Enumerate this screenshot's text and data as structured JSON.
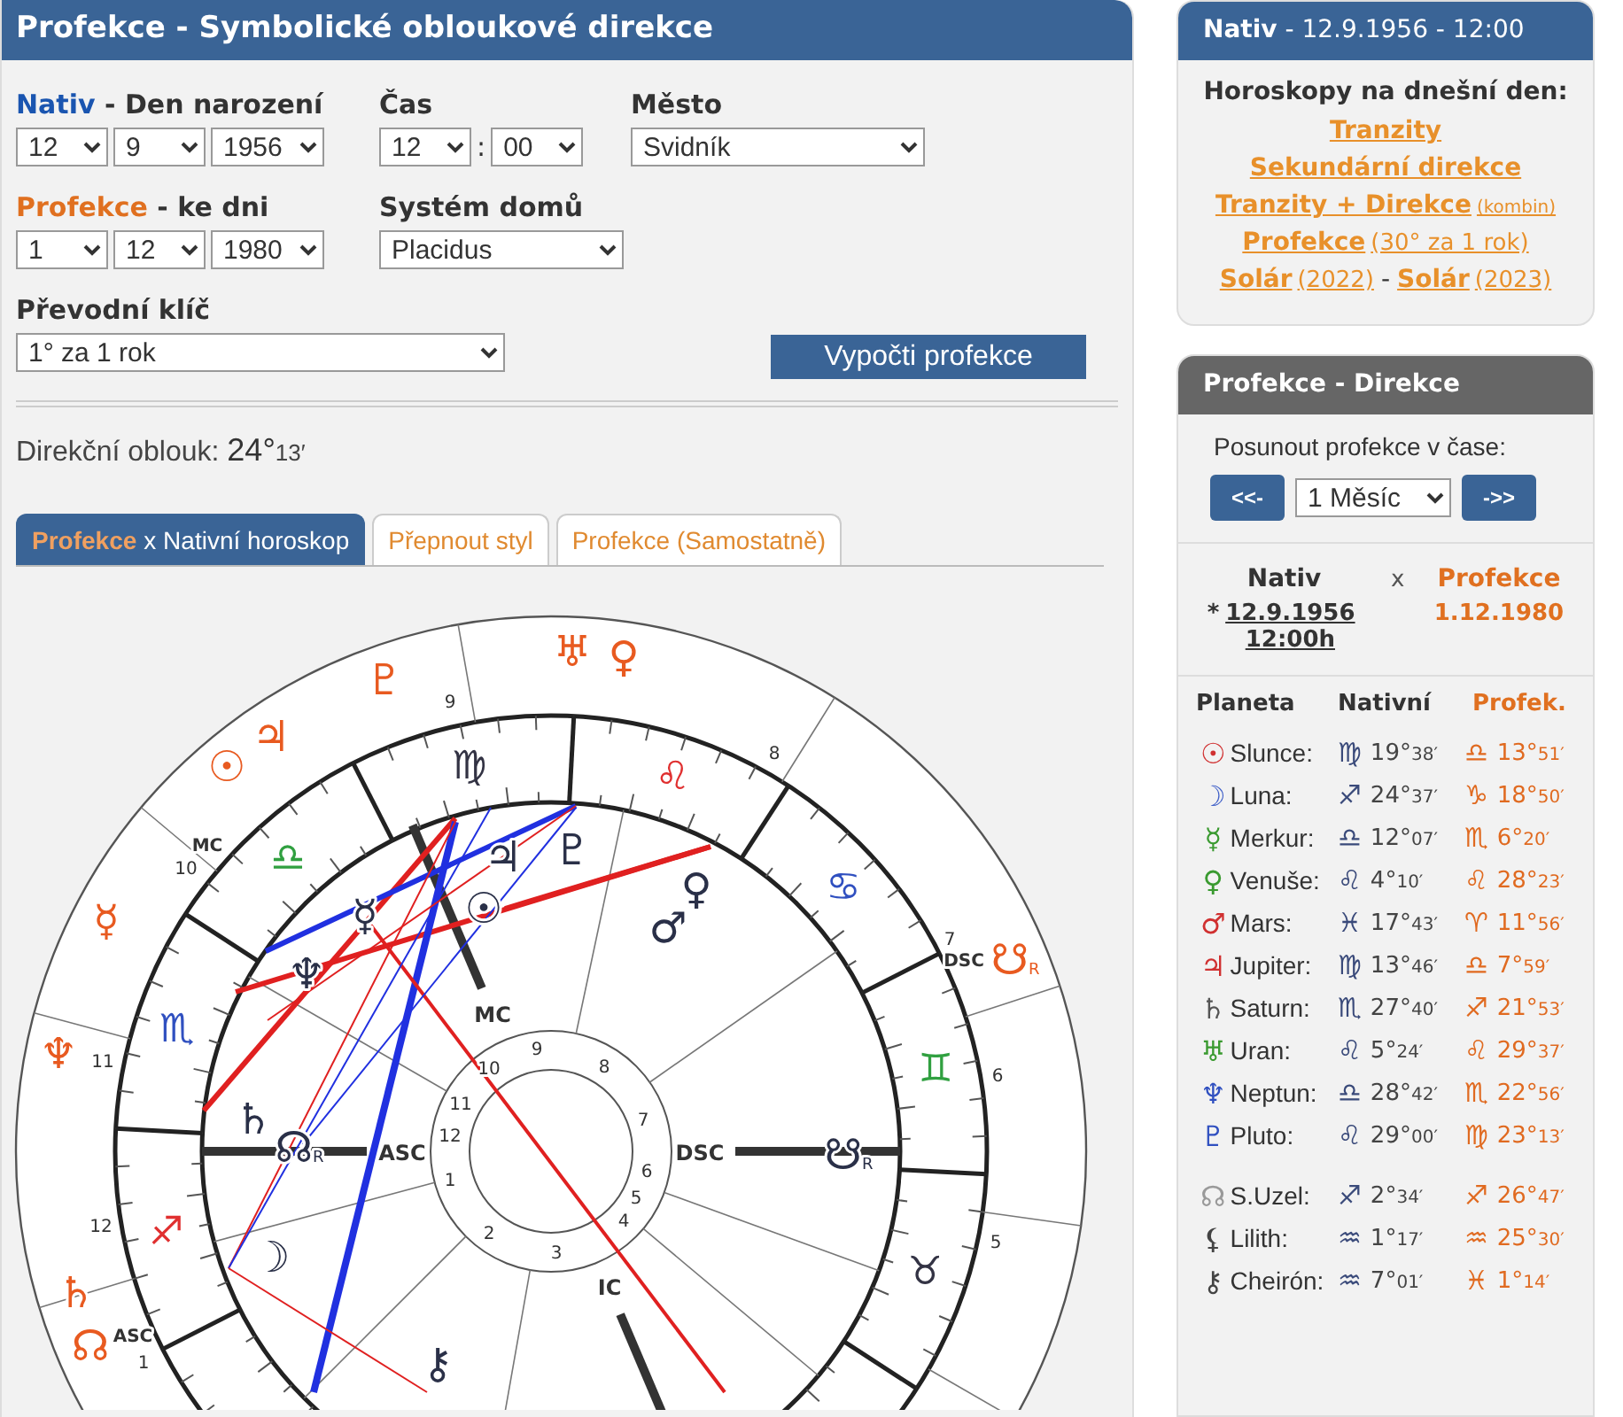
{
  "main": {
    "title": "Profekce - Symbolické obloukové direkce",
    "natal": {
      "label": "Nativ",
      "label_rest": "- Den narození",
      "day": "12",
      "month": "9",
      "year": "1956"
    },
    "time": {
      "label": "Čas",
      "hour": "12",
      "separator": ":",
      "minute": "00"
    },
    "city": {
      "label": "Město",
      "value": "Svidník"
    },
    "progression": {
      "label": "Profekce",
      "label_rest": "- ke dni",
      "day": "1",
      "month": "12",
      "year": "1980"
    },
    "house_system": {
      "label": "Systém domů",
      "value": "Placidus"
    },
    "key": {
      "label": "Převodní klíč",
      "value": "1° za 1 rok"
    },
    "calculate_button": "Vypočti profekce",
    "arc": {
      "label": "Direkční oblouk:",
      "degrees": "24°",
      "minutes": "13′"
    },
    "tabs": [
      {
        "accent": "Profekce",
        "label": "x Nativní horoskop",
        "selected": true
      },
      {
        "label": "Přepnout styl",
        "selected": false
      },
      {
        "label": "Profekce (Samostatně)",
        "selected": false
      }
    ],
    "chart": {
      "zodiac": [
        {
          "glyph": "♌",
          "color": "#e03030"
        },
        {
          "glyph": "♋",
          "color": "#3050c0"
        },
        {
          "glyph": "♊",
          "color": "#30a040"
        },
        {
          "glyph": "♉",
          "color": "#333344"
        },
        {
          "glyph": "♐",
          "color": "#e03030"
        },
        {
          "glyph": "♏",
          "color": "#3050c0"
        },
        {
          "glyph": "♎",
          "color": "#30a040"
        },
        {
          "glyph": "♍",
          "color": "#333344"
        }
      ],
      "natal_planets": [
        {
          "glyph": "♃"
        },
        {
          "glyph": "♇"
        },
        {
          "glyph": "☿"
        },
        {
          "glyph": "☉"
        },
        {
          "glyph": "♀"
        },
        {
          "glyph": "♂"
        },
        {
          "glyph": "♆"
        },
        {
          "glyph": "♄"
        },
        {
          "glyph": "☊",
          "note": "R"
        },
        {
          "glyph": "☽"
        },
        {
          "glyph": "☋",
          "note": "R"
        },
        {
          "glyph": "⚷"
        }
      ],
      "progressed_planets": [
        {
          "glyph": "♅"
        },
        {
          "glyph": "♀"
        },
        {
          "glyph": "♇"
        },
        {
          "glyph": "☉"
        },
        {
          "glyph": "♃"
        },
        {
          "glyph": "☿"
        },
        {
          "glyph": "♆"
        },
        {
          "glyph": "♄"
        },
        {
          "glyph": "☊"
        },
        {
          "glyph": "☋",
          "note": "R"
        }
      ],
      "outer_house_numbers": [
        "9",
        "8",
        "10",
        "7",
        "11",
        "6",
        "12",
        "5",
        "1"
      ],
      "inner_house_numbers": [
        "9",
        "8",
        "10",
        "11",
        "7",
        "12",
        "6",
        "1",
        "5",
        "2",
        "4",
        "3"
      ],
      "angles": [
        "MC",
        "ASC",
        "DSC",
        "IC"
      ],
      "outer_angles": [
        "MC",
        "DSC",
        "ASC"
      ]
    }
  },
  "natal_panel": {
    "title": "Nativ",
    "title_rest": "- 12.9.1956 - 12:00",
    "heading": "Horoskopy na dnešní den:",
    "lines": [
      {
        "links": [
          {
            "text": "Tranzity"
          }
        ]
      },
      {
        "links": [
          {
            "text": "Sekundární direkce"
          }
        ]
      },
      {
        "links": [
          {
            "text": "Tranzity + Direkce",
            "note": "(kombin)"
          }
        ]
      },
      {
        "links": [
          {
            "text": "Profekce",
            "note": "(30° za 1 rok)"
          }
        ]
      },
      {
        "links": [
          {
            "text": "Solár",
            "note": "(2022)"
          },
          {
            "text": "Solár",
            "note": "(2023)"
          }
        ],
        "separator": "-"
      }
    ]
  },
  "direction_panel": {
    "title": "Profekce - Direkce",
    "shift_label": "Posunout profekce v čase:",
    "back_button": "<<-",
    "step": "1 Měsíc",
    "forward_button": "->>",
    "natal_label": "Nativ",
    "times": "x",
    "progression_label": "Profekce",
    "star": "*",
    "natal_date": "12.9.1956 12:00h",
    "progression_date": "1.12.1980",
    "columns": [
      "Planeta",
      "Nativní",
      "Profek."
    ],
    "groups": [
      [
        {
          "icon": "☉",
          "color": "#d03030",
          "name": "Slunce:",
          "natal_sign": "♍",
          "natal_deg": "19°",
          "natal_min": "38′",
          "prog_sign": "♎",
          "prog_deg": "13°",
          "prog_min": "51′"
        },
        {
          "icon": "☽",
          "color": "#4060c8",
          "name": "Luna:",
          "natal_sign": "♐",
          "natal_deg": "24°",
          "natal_min": "37′",
          "prog_sign": "♑",
          "prog_deg": "18°",
          "prog_min": "50′"
        },
        {
          "icon": "☿",
          "color": "#3a9a30",
          "name": "Merkur:",
          "natal_sign": "♎",
          "natal_deg": "12°",
          "natal_min": "07′",
          "prog_sign": "♏",
          "prog_deg": "6°",
          "prog_min": "20′"
        },
        {
          "icon": "♀",
          "color": "#3a9a30",
          "name": "Venuše:",
          "natal_sign": "♌",
          "natal_deg": "4°",
          "natal_min": "10′",
          "prog_sign": "♌",
          "prog_deg": "28°",
          "prog_min": "23′"
        },
        {
          "icon": "♂",
          "color": "#d03030",
          "name": "Mars:",
          "natal_sign": "♓",
          "natal_deg": "17°",
          "natal_min": "43′",
          "prog_sign": "♈",
          "prog_deg": "11°",
          "prog_min": "56′"
        },
        {
          "icon": "♃",
          "color": "#d03030",
          "name": "Jupiter:",
          "natal_sign": "♍",
          "natal_deg": "13°",
          "natal_min": "46′",
          "prog_sign": "♎",
          "prog_deg": "7°",
          "prog_min": "59′"
        },
        {
          "icon": "♄",
          "color": "#555555",
          "name": "Saturn:",
          "natal_sign": "♏",
          "natal_deg": "27°",
          "natal_min": "40′",
          "prog_sign": "♐",
          "prog_deg": "21°",
          "prog_min": "53′"
        },
        {
          "icon": "♅",
          "color": "#3a9a30",
          "name": "Uran:",
          "natal_sign": "♌",
          "natal_deg": "5°",
          "natal_min": "24′",
          "prog_sign": "♌",
          "prog_deg": "29°",
          "prog_min": "37′"
        },
        {
          "icon": "♆",
          "color": "#3050c0",
          "name": "Neptun:",
          "natal_sign": "♎",
          "natal_deg": "28°",
          "natal_min": "42′",
          "prog_sign": "♏",
          "prog_deg": "22°",
          "prog_min": "56′"
        },
        {
          "icon": "♇",
          "color": "#3050c0",
          "name": "Pluto:",
          "natal_sign": "♌",
          "natal_deg": "29°",
          "natal_min": "00′",
          "prog_sign": "♍",
          "prog_deg": "23°",
          "prog_min": "13′"
        }
      ],
      [
        {
          "icon": "☊",
          "color": "#999999",
          "name": "S.Uzel:",
          "natal_sign": "♐",
          "natal_deg": "2°",
          "natal_min": "34′",
          "prog_sign": "♐",
          "prog_deg": "26°",
          "prog_min": "47′"
        },
        {
          "icon": "⚸",
          "color": "#444444",
          "name": "Lilith:",
          "natal_sign": "♒",
          "natal_deg": "1°",
          "natal_min": "17′",
          "prog_sign": "♒",
          "prog_deg": "25°",
          "prog_min": "30′"
        },
        {
          "icon": "⚷",
          "color": "#444444",
          "name": "Cheirón:",
          "natal_sign": "♒",
          "natal_deg": "7°",
          "natal_min": "01′",
          "prog_sign": "♓",
          "prog_deg": "1°",
          "prog_min": "14′"
        }
      ]
    ]
  }
}
